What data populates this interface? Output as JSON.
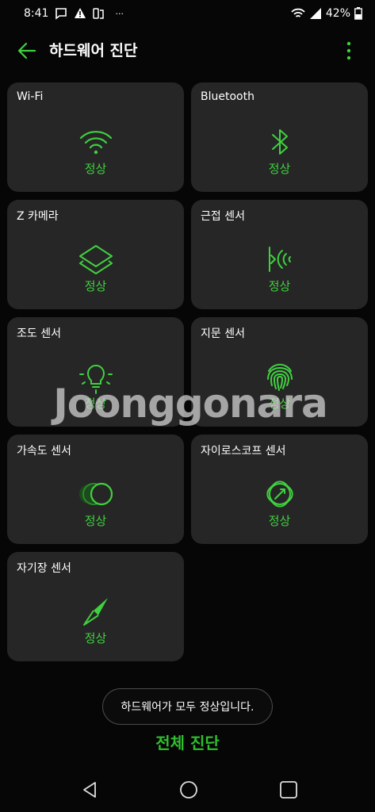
{
  "status_bar": {
    "time": "8:41",
    "battery": "42%"
  },
  "header": {
    "title": "하드웨어 진단"
  },
  "status_text": "정상",
  "cards": [
    {
      "title": "Wi-Fi",
      "icon": "wifi-icon"
    },
    {
      "title": "Bluetooth",
      "icon": "bluetooth-icon"
    },
    {
      "title": "Z 카메라",
      "icon": "layers-icon"
    },
    {
      "title": "근접 센서",
      "icon": "proximity-icon"
    },
    {
      "title": "조도 센서",
      "icon": "light-bulb-icon"
    },
    {
      "title": "지문 센서",
      "icon": "fingerprint-icon"
    },
    {
      "title": "가속도 센서",
      "icon": "accelerometer-icon"
    },
    {
      "title": "자이로스코프 센서",
      "icon": "gyroscope-icon"
    },
    {
      "title": "자기장 센서",
      "icon": "compass-icon"
    }
  ],
  "card_statuses": [
    "정상",
    "정상",
    "정상",
    "정상",
    "정상",
    "정상",
    "정상",
    "정상",
    "정상"
  ],
  "watermark": "Joonggonara",
  "toast": "하드웨어가 모두 정상입니다.",
  "action": {
    "label": "전체 진단"
  },
  "colors": {
    "accent": "#3fd13f",
    "card_bg": "#262626",
    "background": "#060606"
  }
}
